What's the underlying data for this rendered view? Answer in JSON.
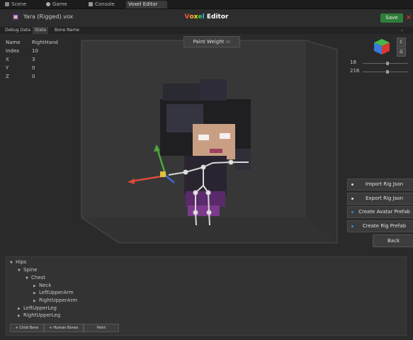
{
  "tabs": [
    {
      "label": "Scene",
      "icon": "scene-icon"
    },
    {
      "label": "Game",
      "icon": "game-icon"
    },
    {
      "label": "Console",
      "icon": "console-icon"
    },
    {
      "label": "Voxel Editor",
      "icon": ""
    }
  ],
  "header": {
    "file_name": "Yara (Rigged).vox",
    "title_letters": [
      "V",
      "o",
      "x",
      "e",
      "l",
      " ",
      "E",
      "d",
      "i",
      "t",
      "o",
      "r"
    ],
    "title_colors": [
      "#ff5050",
      "#ffb020",
      "#ffe030",
      "#40d040",
      "#40b0ff",
      "#ffffff",
      "#ffffff",
      "#ffffff",
      "#ffffff",
      "#ffffff",
      "#ffffff",
      "#ffffff"
    ],
    "save_label": "Save",
    "close_glyph": "✕"
  },
  "subtabs": [
    "Debug Data",
    "State",
    "Bone Name"
  ],
  "info": {
    "rows": [
      {
        "label": "Name",
        "value": "RightHand"
      },
      {
        "label": "Index",
        "value": "10"
      },
      {
        "label": "X",
        "value": "3"
      },
      {
        "label": "Y",
        "value": "0"
      },
      {
        "label": "Z",
        "value": "0"
      }
    ]
  },
  "viewport": {
    "paint_weight_label": "Paint Weight",
    "paint_weight_key": "(P)",
    "slider1_value": "18",
    "slider2_value": "216",
    "slider1_fraction": 0.55,
    "slider2_fraction": 0.55,
    "btn_c": "C",
    "btn_g": "G"
  },
  "actions": {
    "import_label": "Import Rig Json",
    "export_label": "Export Rig Json",
    "avatar_label": "Create Avatar Prefab",
    "rig_label": "Create Rig Prefab",
    "back_label": "Back"
  },
  "hierarchy": {
    "nodes": [
      {
        "label": "Hips",
        "expanded": true
      },
      {
        "label": "Spine",
        "expanded": true
      },
      {
        "label": "Chest",
        "expanded": true
      },
      {
        "label": "Neck",
        "expanded": false
      },
      {
        "label": "LeftUpperArm",
        "expanded": false
      },
      {
        "label": "RightUpperArm",
        "expanded": false
      },
      {
        "label": "LeftUpperLeg",
        "expanded": false
      },
      {
        "label": "RightUpperLeg",
        "expanded": false
      }
    ],
    "buttons": {
      "child_bone": "+ Child Bone",
      "human_bones": "+ Human Bones",
      "paint": "Paint"
    }
  },
  "colors": {
    "save_green": "#2f7d3a",
    "close_red": "#d9382f",
    "accent_blue": "#2f8fd0"
  }
}
